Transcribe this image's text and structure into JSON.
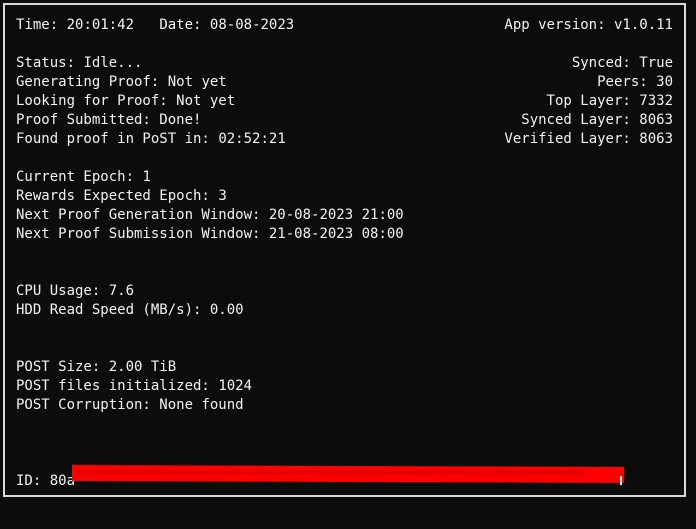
{
  "header": {
    "time_label": "Time:",
    "time": "20:01:42",
    "date_label": "Date:",
    "date": "08-08-2023",
    "version_label": "App version:",
    "version": "v1.0.11"
  },
  "status": {
    "status_label": "Status:",
    "status": "Idle...",
    "generating_label": "Generating Proof:",
    "generating": "Not yet",
    "looking_label": "Looking for Proof:",
    "looking": "Not yet",
    "submitted_label": "Proof Submitted:",
    "submitted": "Done!",
    "found_label": "Found proof in PoST in:",
    "found": "02:52:21"
  },
  "node": {
    "synced_label": "Synced:",
    "synced": "True",
    "peers_label": "Peers:",
    "peers": "30",
    "top_layer_label": "Top Layer:",
    "top_layer": "7332",
    "synced_layer_label": "Synced Layer:",
    "synced_layer": "8063",
    "verified_layer_label": "Verified Layer:",
    "verified_layer": "8063"
  },
  "epoch": {
    "current_label": "Current Epoch:",
    "current": "1",
    "rewards_label": "Rewards Expected Epoch:",
    "rewards": "3",
    "gen_window_label": "Next Proof Generation Window:",
    "gen_window": "20-08-2023 21:00",
    "sub_window_label": "Next Proof Submission Window:",
    "sub_window": "21-08-2023 08:00"
  },
  "system": {
    "cpu_label": "CPU Usage:",
    "cpu": "7.6",
    "hdd_label": "HDD Read Speed (MB/s):",
    "hdd": "0.00"
  },
  "post": {
    "size_label": "POST Size:",
    "size": "2.00 TiB",
    "files_label": "POST files initialized:",
    "files": "1024",
    "corruption_label": "POST Corruption:",
    "corruption": "None found"
  },
  "footer": {
    "id_label": "ID:",
    "id_visible": "80a"
  },
  "colors": {
    "background": "#0c0c0c",
    "text": "#f2f2f2",
    "border": "#d9d9d9",
    "redaction": "#ff0000"
  }
}
